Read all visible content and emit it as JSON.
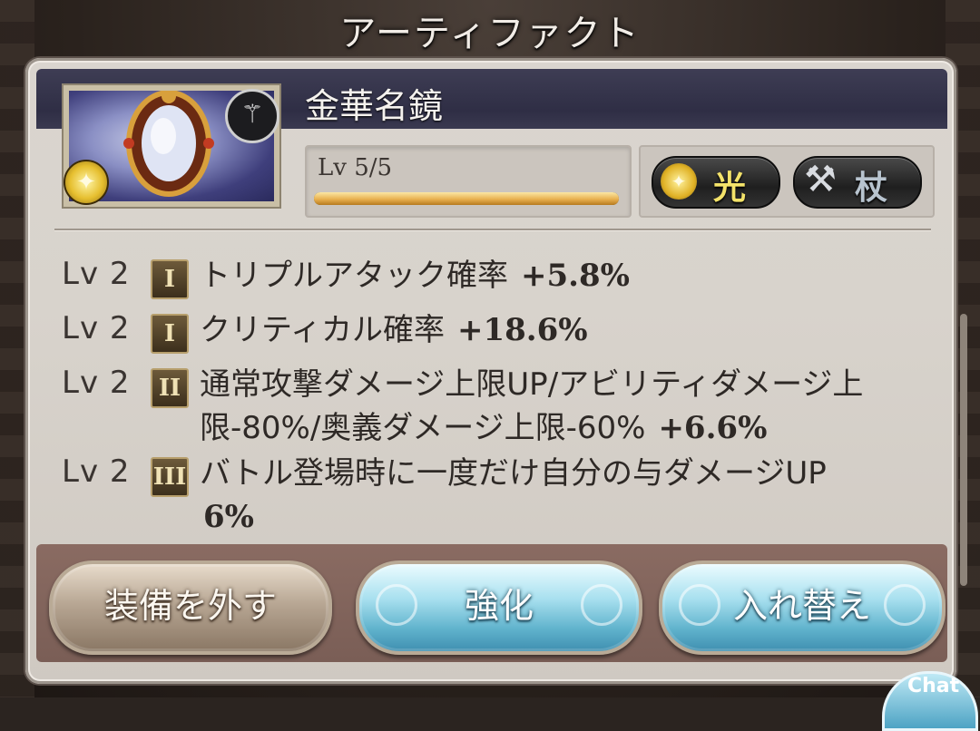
{
  "window": {
    "title": "アーティファクト"
  },
  "artifact": {
    "name": "金華名鏡",
    "level_label": "Lv 5/5",
    "level_progress": 1.0,
    "element_tag": "光",
    "weapon_tag": "杖"
  },
  "skills": [
    {
      "level": "Lv 2",
      "rank": "I",
      "text": "トリプルアタック確率",
      "value": "+5.8%"
    },
    {
      "level": "Lv 2",
      "rank": "I",
      "text": "クリティカル確率",
      "value": "+18.6%"
    },
    {
      "level": "Lv 2",
      "rank": "II",
      "text": "通常攻撃ダメージ上限UP/アビリティダメージ上限-80%/奥義ダメージ上限-60%",
      "value": "+6.6%"
    },
    {
      "level": "Lv 2",
      "rank": "III",
      "text": "バトル登場時に一度だけ自分の与ダメージUP",
      "value": "6%"
    }
  ],
  "buttons": {
    "unequip": "装備を外す",
    "enhance": "強化",
    "swap": "入れ替え"
  },
  "icons": {
    "weapon_badge": "staff-icon",
    "element_badge": "light-element-icon"
  },
  "chat": {
    "label": "Chat"
  }
}
